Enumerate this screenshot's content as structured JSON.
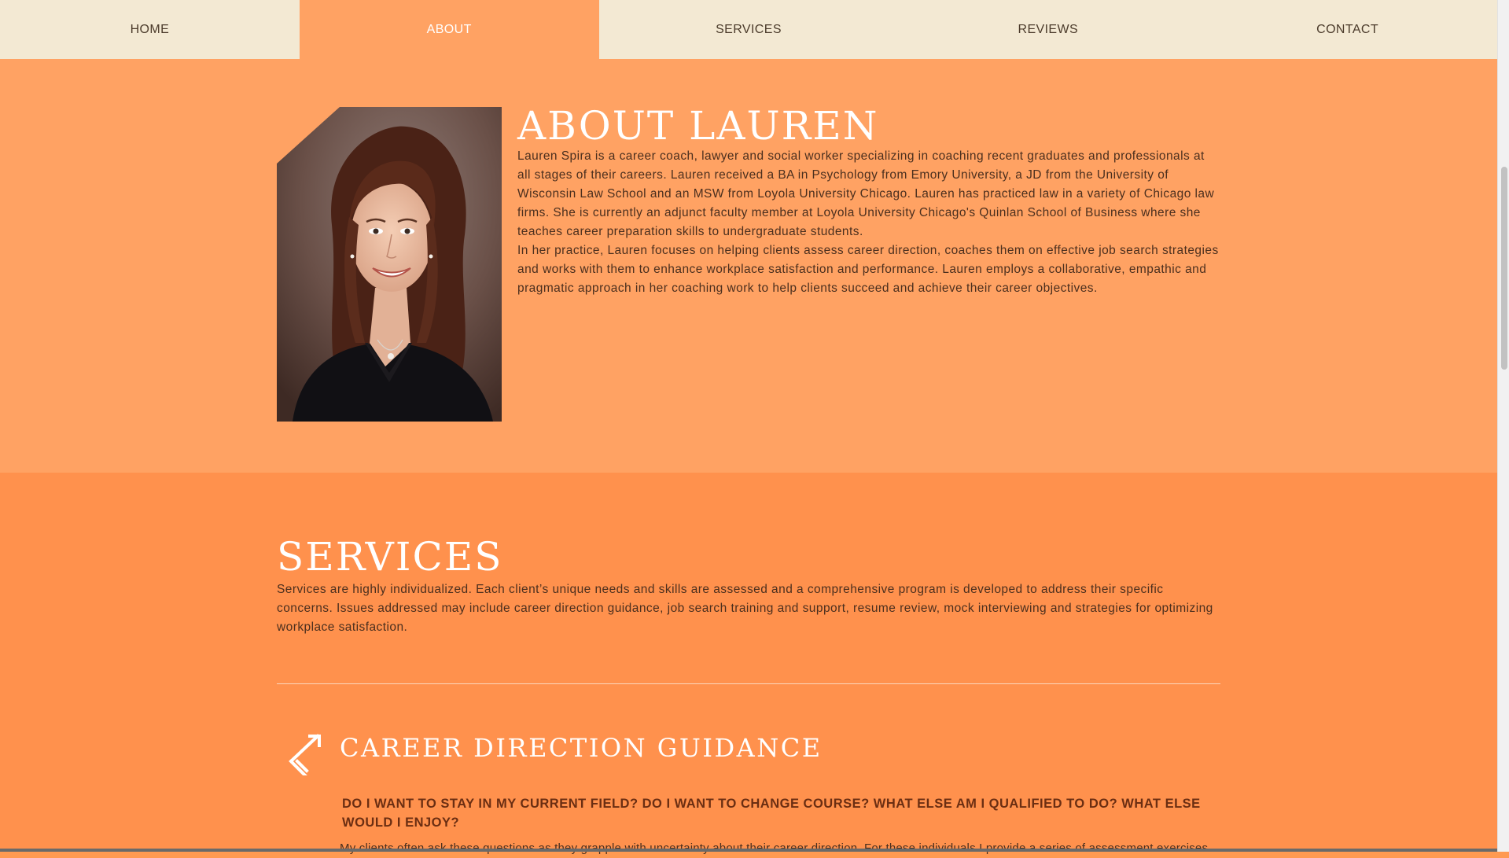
{
  "nav": {
    "items": [
      {
        "label": "HOME",
        "active": false
      },
      {
        "label": "ABOUT",
        "active": true
      },
      {
        "label": "SERVICES",
        "active": false
      },
      {
        "label": "REVIEWS",
        "active": false
      },
      {
        "label": "CONTACT",
        "active": false
      }
    ]
  },
  "about": {
    "title": "ABOUT LAUREN",
    "paragraph1": "Lauren Spira is a career coach, lawyer and social worker specializing in coaching recent graduates and professionals at all stages of their careers. Lauren received a BA in Psychology from Emory University, a JD from the University of Wisconsin Law School and an MSW from Loyola University Chicago. Lauren has practiced law in a variety of Chicago law firms. She is currently an adjunct faculty member at Loyola University Chicago's Quinlan School of Business where she teaches career preparation skills to undergraduate students.",
    "paragraph2": "In her practice, Lauren focuses on helping clients assess career direction, coaches them on effective job search strategies and works with them to enhance workplace satisfaction and performance. Lauren employs a collaborative, empathic and pragmatic approach in her coaching work to help clients succeed and achieve their career objectives."
  },
  "services": {
    "title": "SERVICES",
    "intro": "Services are highly individualized. Each client’s unique needs and skills are assessed and a comprehensive program is developed to address their specific concerns. Issues addressed may include career direction guidance, job search training and support, resume review, mock interviewing and strategies for optimizing workplace satisfaction.",
    "guidance": {
      "icon": "arrow-icon",
      "title": "CAREER DIRECTION GUIDANCE",
      "question": "DO I WANT TO STAY IN MY CURRENT FIELD? DO I WANT TO CHANGE COURSE? WHAT ELSE AM I QUALIFIED TO DO? WHAT ELSE WOULD I ENJOY?",
      "body": "My clients often ask these questions as they grapple with uncertainty about their career direction. For these individuals I provide a series of assessment exercises"
    }
  },
  "colors": {
    "nav_bg": "#f3e9d3",
    "nav_active": "#ffa263",
    "about_bg": "#ffa263",
    "services_bg": "#ff914d",
    "heading": "#ffffff",
    "body_text": "#4b2f1e"
  }
}
